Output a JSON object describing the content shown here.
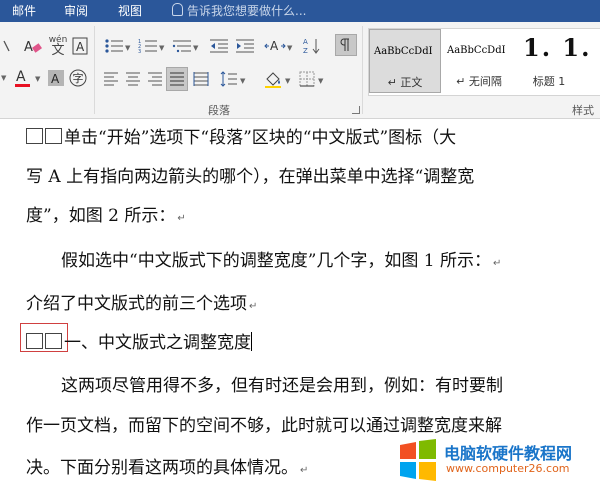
{
  "tabs": [
    "邮件",
    "审阅",
    "视图"
  ],
  "tell_me": "告诉我您想要做什么...",
  "ribbon": {
    "paragraph_group_label": "段落",
    "styles_group_label": "样式",
    "phonetic_guide": "wén",
    "styles": [
      {
        "sample": "AaBbCcDdI",
        "name": "↵ 正文",
        "selected": true
      },
      {
        "sample": "AaBbCcDdI",
        "name": "↵ 无间隔",
        "selected": false
      },
      {
        "sample": "1. 1.",
        "name": "标题 1",
        "selected": false
      }
    ],
    "font_color": "#e81123"
  },
  "document": {
    "lines": [
      "□□单击“开始”选项下“段落”区块的“中文版式”图标（大",
      "写 A 上有指向两边箭头的哪个），在弹出菜单中选择“调整宽",
      "度”，如图 2 所示：",
      "假如选中“中文版式下的调整宽度”几个字，如图 1 所示：",
      "介绍了中文版式的前三个选项",
      "一、中文版式之调整宽度",
      "这两项尽管用得不多，但有时还是会用到，例如：有时要制",
      "作一页文档，而留下的空间不够，此时就可以通过调整宽度来解",
      "决。下面分别看这两项的具体情况。"
    ],
    "line1_text": "单击“开始”选项下“段落”区块的“中文版式”图标（大",
    "heading_text": "一、中文版式之调整宽度"
  },
  "watermark": {
    "title": "电脑软硬件教程网",
    "url": "www.computer26.com"
  }
}
